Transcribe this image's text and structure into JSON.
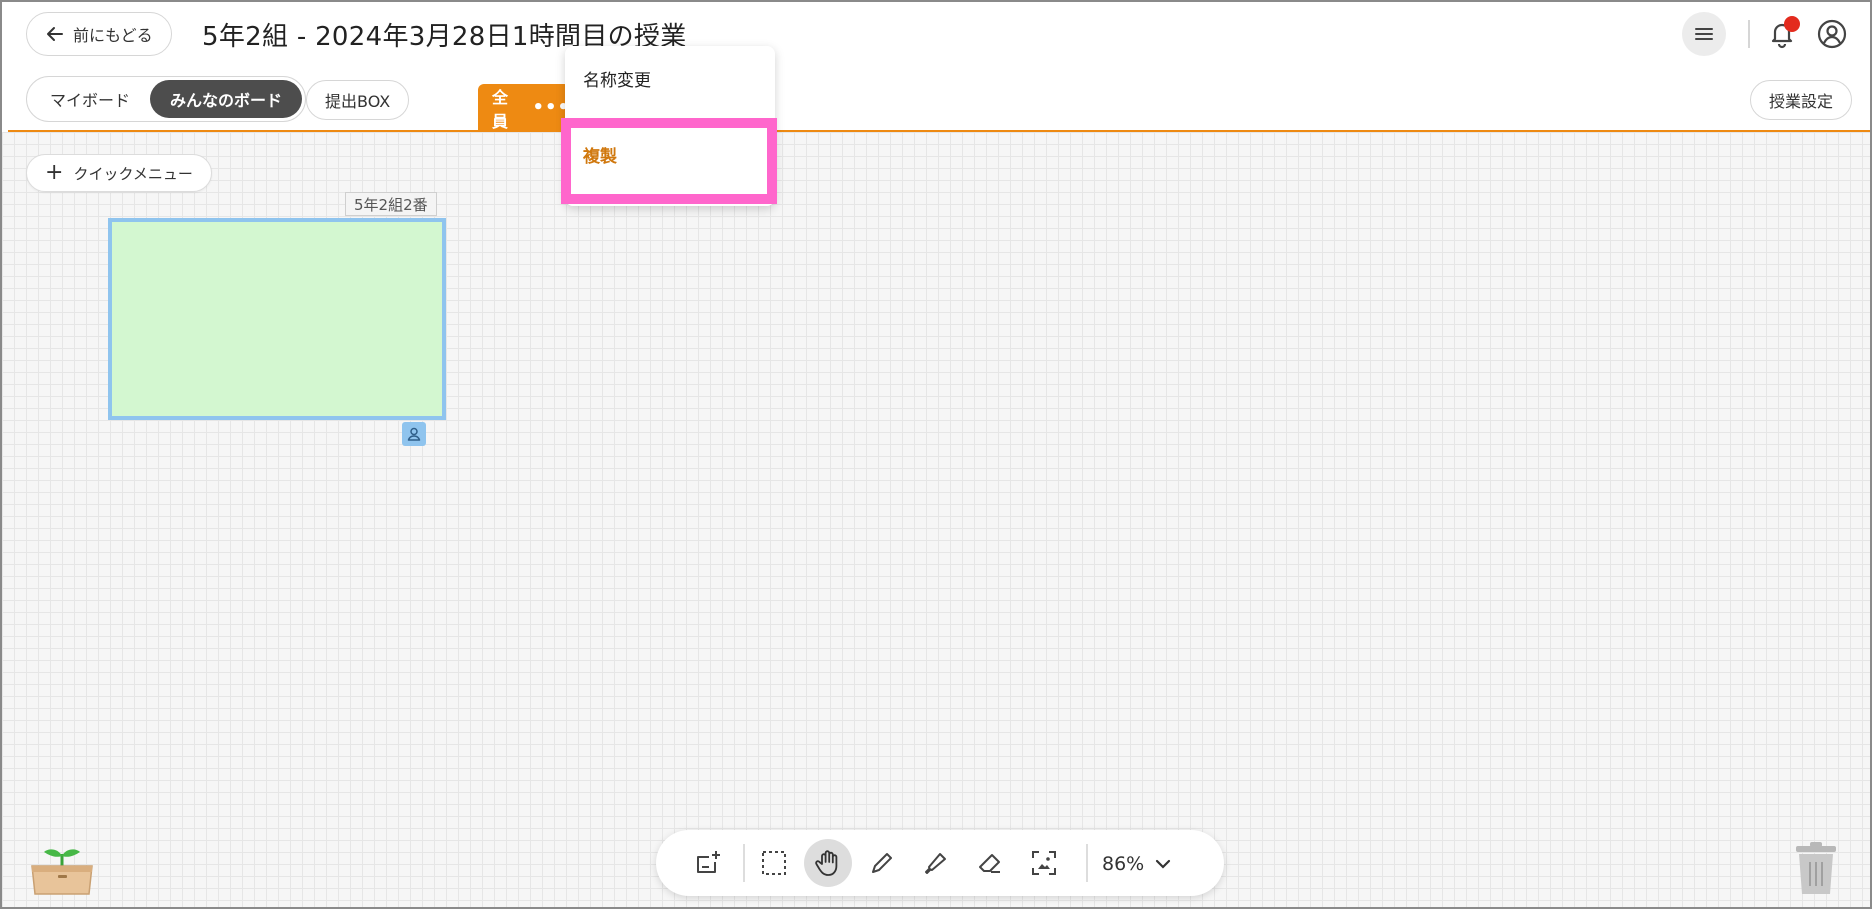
{
  "header": {
    "back_label": "前にもどる",
    "title": "5年2組 - 2024年3月28日1時間目の授業",
    "menu_icon": "hamburger-icon",
    "bell_icon": "bell-icon",
    "user_icon": "user-circle-icon",
    "notification_dot_color": "#e32b1e"
  },
  "board_tabs": {
    "segments": [
      {
        "label": "マイボード",
        "active": false
      },
      {
        "label": "みんなのボード",
        "active": true
      }
    ],
    "submit_box": "提出BOX",
    "group_tab": {
      "label": "全員",
      "more": "•••",
      "color": "#ee8a12"
    },
    "lesson_settings": "授業設定"
  },
  "dropdown": {
    "items": [
      {
        "label": "名称変更"
      },
      {
        "label": "複製",
        "highlighted": true
      }
    ],
    "highlight_color": "#ff66cc",
    "active_text_color": "#d0780e"
  },
  "canvas": {
    "quick_menu": {
      "plus": "+",
      "label": "クイックメニュー"
    },
    "card": {
      "label": "5年2組2番",
      "fill": "#d3f7d0",
      "border": "#8fc4ee",
      "owner_icon": "person-icon"
    }
  },
  "toolbar": {
    "tools": [
      "add-card-icon",
      "select-area-icon",
      "hand-icon",
      "pen-icon",
      "marker-icon",
      "eraser-icon",
      "image-frame-icon"
    ],
    "active_tool": "hand-icon",
    "zoom": "86%"
  },
  "decor": {
    "sprout_icon": "sprout-box-icon",
    "trash_icon": "trash-icon"
  }
}
